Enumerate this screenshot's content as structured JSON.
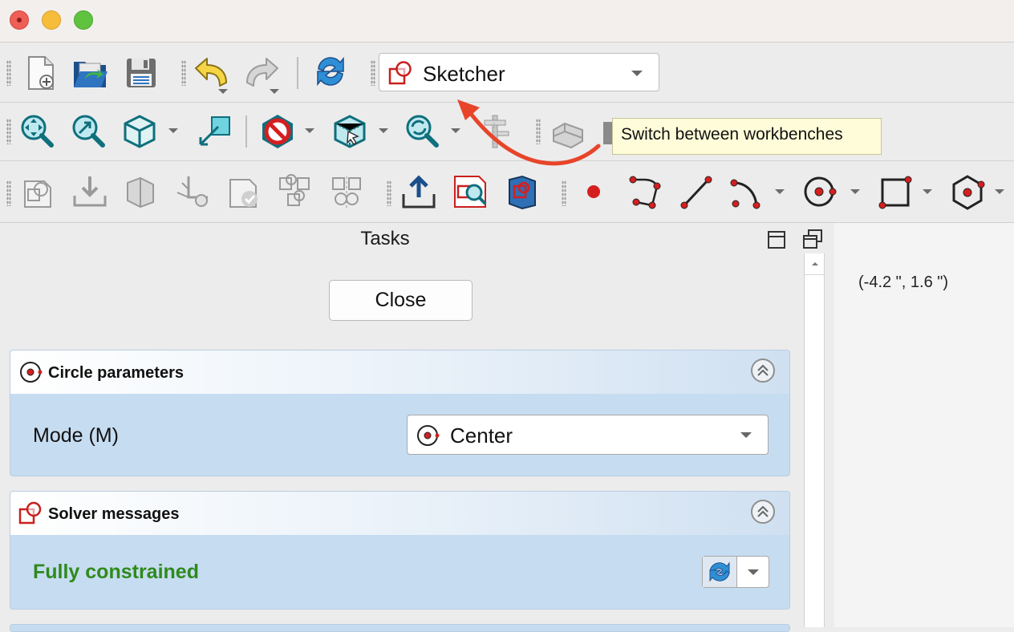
{
  "window": {
    "controls": [
      "close",
      "minimize",
      "zoom"
    ]
  },
  "toolbar1": {
    "icons": [
      "new-document-icon",
      "open-folder-icon",
      "save-icon",
      "undo-icon",
      "redo-icon",
      "refresh-icon"
    ],
    "workbench": {
      "label": "Sketcher",
      "icon": "sketcher-icon"
    }
  },
  "tooltip": {
    "text": "Switch between workbenches"
  },
  "annotation": {
    "arrow_color": "#e8442a"
  },
  "toolbar2": {
    "icons": [
      "fit-all-icon",
      "fit-selection-icon",
      "view-cube-icon",
      "measure-line-icon",
      "no-draw-style-icon",
      "bounding-box-icon",
      "refresh-zoom-icon",
      "caliper-icon",
      "part-icon"
    ]
  },
  "toolbar3": {
    "icons": [
      "new-sketch-icon",
      "import-sketch-icon",
      "map-sketch-icon",
      "reorient-icon",
      "validate-sketch-icon",
      "merge-sketches-icon",
      "mirror-sketch-icon",
      "leave-sketch-icon",
      "view-sketch-icon",
      "view-section-icon",
      "point-icon",
      "polyline-icon",
      "line-icon",
      "arc-icon",
      "circle-icon",
      "rectangle-icon",
      "hexagon-icon"
    ]
  },
  "panel": {
    "title": "Tasks",
    "close_label": "Close",
    "circle_params": {
      "title": "Circle parameters",
      "mode_label": "Mode (M)",
      "mode_value": "Center"
    },
    "solver": {
      "title": "Solver messages",
      "status": "Fully constrained",
      "status_color": "#2e8a1b"
    }
  },
  "view": {
    "coordinates": "(-4.2 \", 1.6 \")"
  },
  "colors": {
    "accent_red": "#d51f1f",
    "teal": "#1aa1b5",
    "panel_blue": "#c6dcf1"
  }
}
